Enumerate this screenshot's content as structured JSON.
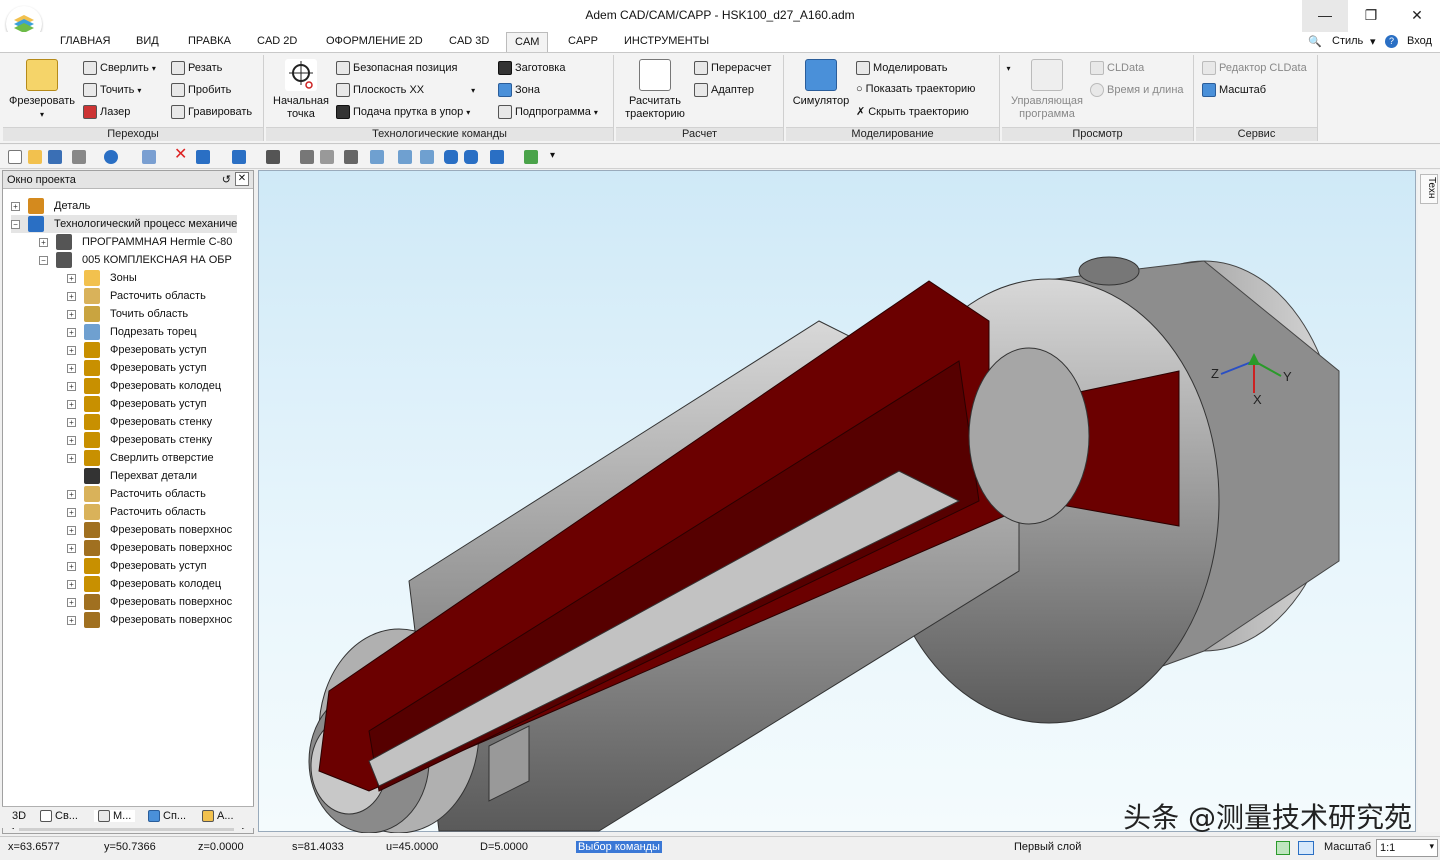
{
  "window": {
    "title": "Adem CAD/CAM/CAPP - HSK100_d27_A160.adm"
  },
  "menu": {
    "tabs": [
      "ГЛАВНАЯ",
      "ВИД",
      "ПРАВКА",
      "CAD 2D",
      "ОФОРМЛЕНИЕ 2D",
      "CAD 3D",
      "CAM",
      "CAPP",
      "ИНСТРУМЕНТЫ"
    ],
    "active": "CAM",
    "right": {
      "style_label": "Стиль",
      "login_label": "Вход"
    }
  },
  "ribbon": {
    "perekhody": {
      "label": "Переходы",
      "big": "Фрезеровать",
      "items": [
        "Сверлить",
        "Резать",
        "Точить",
        "Пробить",
        "Лазер",
        "Гравировать"
      ]
    },
    "tech": {
      "label": "Технологические команды",
      "big_line1": "Начальная",
      "big_line2": "точка",
      "items": [
        "Безопасная позиция",
        "Заготовка",
        "Плоскость XX",
        "Зона",
        "Подача прутка в упор",
        "Подпрограмма"
      ]
    },
    "raschet": {
      "label": "Расчет",
      "big_line1": "Расчитать",
      "big_line2": "траекторию",
      "items": [
        "Перерасчет",
        "Адаптер"
      ]
    },
    "model": {
      "label": "Моделирование",
      "big": "Симулятор",
      "items": [
        "Моделировать",
        "Показать траекторию",
        "Скрыть траекторию"
      ]
    },
    "prosmotr": {
      "label": "Просмотр",
      "big_line1": "Управляющая",
      "big_line2": "программа",
      "items": [
        "CLData",
        "Время и длина"
      ]
    },
    "servis": {
      "label": "Сервис",
      "items": [
        "Редактор CLData",
        "Масштаб"
      ]
    }
  },
  "project": {
    "title": "Окно проекта",
    "tree": [
      {
        "label": "Деталь",
        "level": 0
      },
      {
        "label": "Технологический процесс механиче",
        "level": 0
      },
      {
        "label": "ПРОГРАММНАЯ Hermle C-80",
        "level": 1
      },
      {
        "label": "005  КОМПЛЕКСНАЯ НА ОБР",
        "level": 1
      },
      {
        "label": "Зоны",
        "level": 2
      },
      {
        "label": "Расточить область",
        "level": 2
      },
      {
        "label": "Точить область",
        "level": 2
      },
      {
        "label": "Подрезать торец",
        "level": 2
      },
      {
        "label": "Фрезеровать уступ",
        "level": 2
      },
      {
        "label": "Фрезеровать уступ",
        "level": 2
      },
      {
        "label": "Фрезеровать колодец",
        "level": 2
      },
      {
        "label": "Фрезеровать уступ",
        "level": 2
      },
      {
        "label": "Фрезеровать стенку",
        "level": 2
      },
      {
        "label": "Фрезеровать стенку",
        "level": 2
      },
      {
        "label": "Сверлить отверстие",
        "level": 2
      },
      {
        "label": "Перехват детали",
        "level": 2
      },
      {
        "label": "Расточить область",
        "level": 2
      },
      {
        "label": "Расточить область",
        "level": 2
      },
      {
        "label": "Фрезеровать поверхнос",
        "level": 2
      },
      {
        "label": "Фрезеровать поверхнос",
        "level": 2
      },
      {
        "label": "Фрезеровать уступ",
        "level": 2
      },
      {
        "label": "Фрезеровать колодец",
        "level": 2
      },
      {
        "label": "Фрезеровать поверхнос",
        "level": 2
      },
      {
        "label": "Фрезеровать поверхнос",
        "level": 2
      }
    ],
    "tabs": [
      "3D",
      "Св...",
      "М...",
      "Сп...",
      "А..."
    ]
  },
  "viewport": {
    "axis_x": "X",
    "axis_y": "Y",
    "axis_z": "Z",
    "side_tab": "Техн"
  },
  "status": {
    "x": "x=63.6577",
    "y": "y=50.7366",
    "z": "z=0.0000",
    "s": "s=81.4033",
    "u": "u=45.0000",
    "d": "D=5.0000",
    "command": "Выбор команды",
    "layer": "Первый слой",
    "scale_label": "Масштаб",
    "scale_value": "1:1"
  },
  "watermark": "头条 @测量技术研究苑",
  "colors": {
    "section": "#6b0000",
    "metal": "#9a9a9a",
    "accent": "#4a90d9"
  }
}
